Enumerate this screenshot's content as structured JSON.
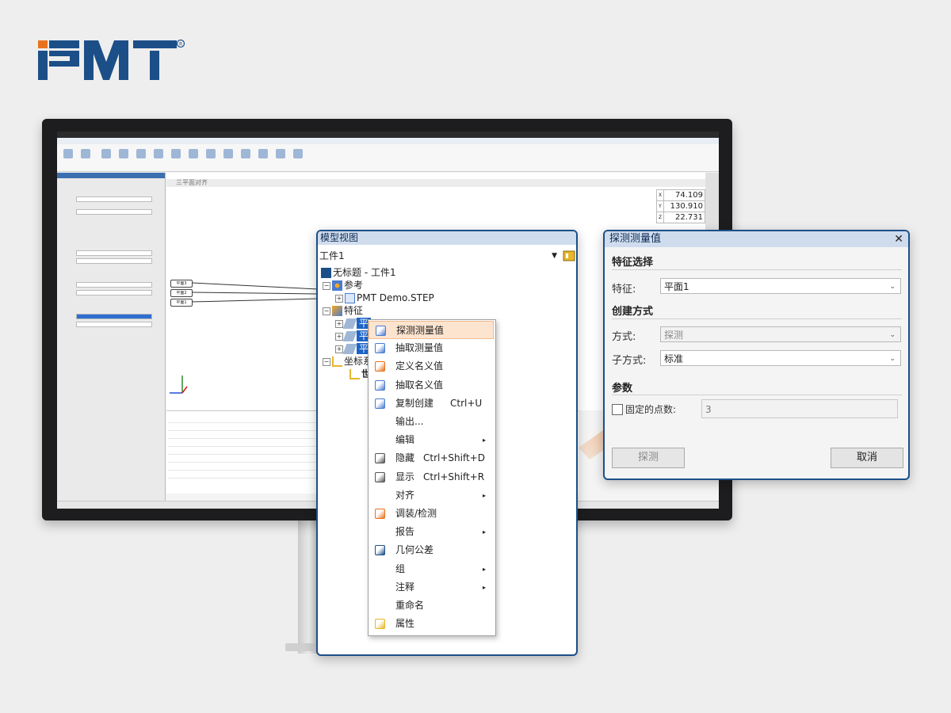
{
  "brand": {
    "logo_text": "PMT",
    "accent": "#e8731f",
    "navy": "#1c4f88"
  },
  "mini_app": {
    "view_title": "三平面对齐",
    "plane_tags": [
      "平面3",
      "平面2",
      "平面1"
    ],
    "coords": [
      {
        "axis": "X",
        "value": "74.109"
      },
      {
        "axis": "Y",
        "value": "130.910"
      },
      {
        "axis": "Z",
        "value": "22.731"
      }
    ]
  },
  "model_panel": {
    "title": "模型视图",
    "workpiece_select": "工件1",
    "tree": {
      "root": "无标题 - 工件1",
      "reference": "参考",
      "step_file": "PMT Demo.STEP",
      "features": "特征",
      "feature_items": [
        "平",
        "平",
        "平"
      ],
      "coord_system": "坐标系",
      "world": "世"
    }
  },
  "context_menu": {
    "items": [
      {
        "label": "探测测量值",
        "icon": "probe-measure-icon",
        "highlighted": true
      },
      {
        "label": "抽取测量值",
        "icon": "extract-measure-icon"
      },
      {
        "label": "定义名义值",
        "icon": "define-nominal-icon"
      },
      {
        "label": "抽取名义值",
        "icon": "extract-nominal-icon"
      },
      {
        "label": "复制创建",
        "icon": "copy-create-icon",
        "shortcut": "Ctrl+U"
      },
      {
        "label": "输出..."
      },
      {
        "label": "编辑",
        "submenu": true
      },
      {
        "label": "隐藏",
        "icon": "hide-icon",
        "shortcut": "Ctrl+Shift+D"
      },
      {
        "label": "显示",
        "icon": "show-icon",
        "shortcut": "Ctrl+Shift+R"
      },
      {
        "label": "对齐",
        "submenu": true
      },
      {
        "label": "调装/检测",
        "icon": "fit-inspect-icon"
      },
      {
        "label": "报告",
        "submenu": true
      },
      {
        "label": "几何公差",
        "icon": "gdt-icon"
      },
      {
        "label": "组",
        "submenu": true
      },
      {
        "label": "注释",
        "submenu": true
      },
      {
        "label": "重命名"
      },
      {
        "label": "属性",
        "icon": "properties-icon"
      }
    ]
  },
  "dialog": {
    "title": "探测测量值",
    "close": "✕",
    "section_feature": "特征选择",
    "feature_label": "特征:",
    "feature_value": "平面1",
    "section_create": "创建方式",
    "method_label": "方式:",
    "method_value": "探测",
    "submethod_label": "子方式:",
    "submethod_value": "标准",
    "section_params": "参数",
    "fixed_points_label": "固定的点数:",
    "fixed_points_value": "3",
    "probe_button": "探测",
    "cancel_button": "取消"
  }
}
